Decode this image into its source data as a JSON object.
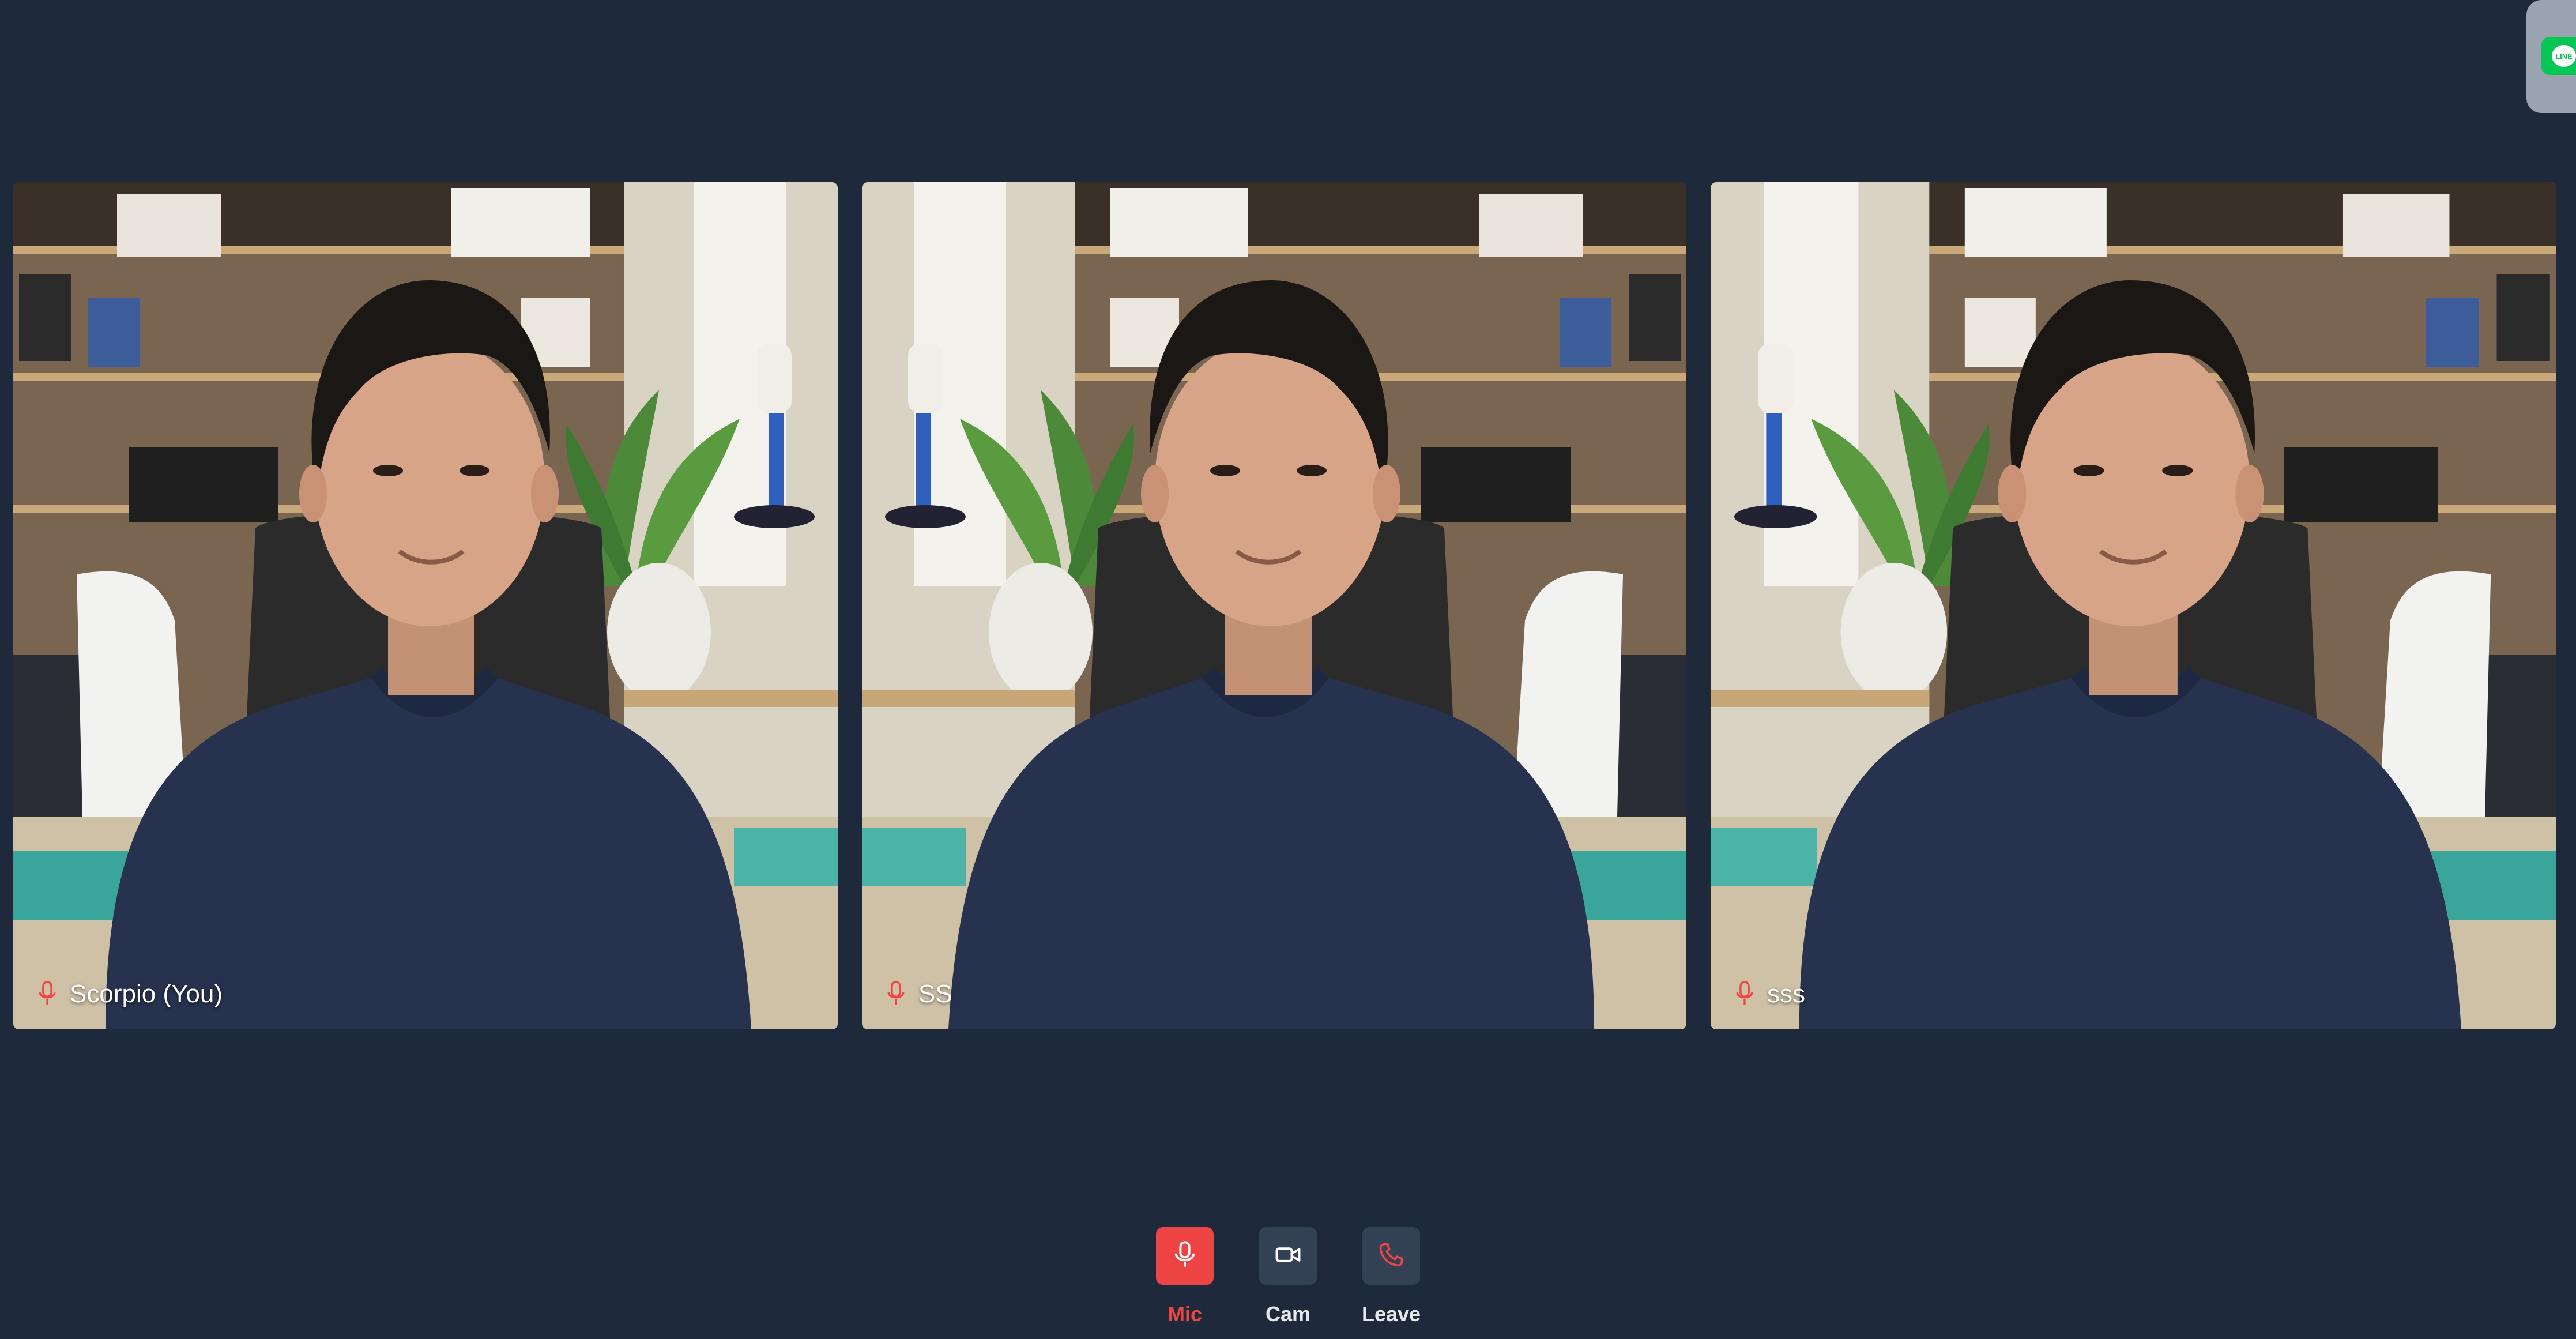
{
  "colors": {
    "background": "#1e293b",
    "control_button": "#334155",
    "mic_active": "#ef4444",
    "line_green": "#06c755"
  },
  "side_widget": {
    "icon": "line-app-icon",
    "icon_text": "LINE"
  },
  "participants": [
    {
      "name": "Scorpio (You)",
      "mic_icon": "mic-muted-icon",
      "mirrored": false
    },
    {
      "name": "SS",
      "mic_icon": "mic-muted-icon",
      "mirrored": true
    },
    {
      "name": "sss",
      "mic_icon": "mic-muted-icon",
      "mirrored": false
    }
  ],
  "controls": {
    "mic": {
      "label": "Mic",
      "icon": "microphone-icon",
      "active": true
    },
    "cam": {
      "label": "Cam",
      "icon": "video-camera-icon",
      "active": false
    },
    "leave": {
      "label": "Leave",
      "icon": "phone-icon",
      "active": false
    }
  }
}
